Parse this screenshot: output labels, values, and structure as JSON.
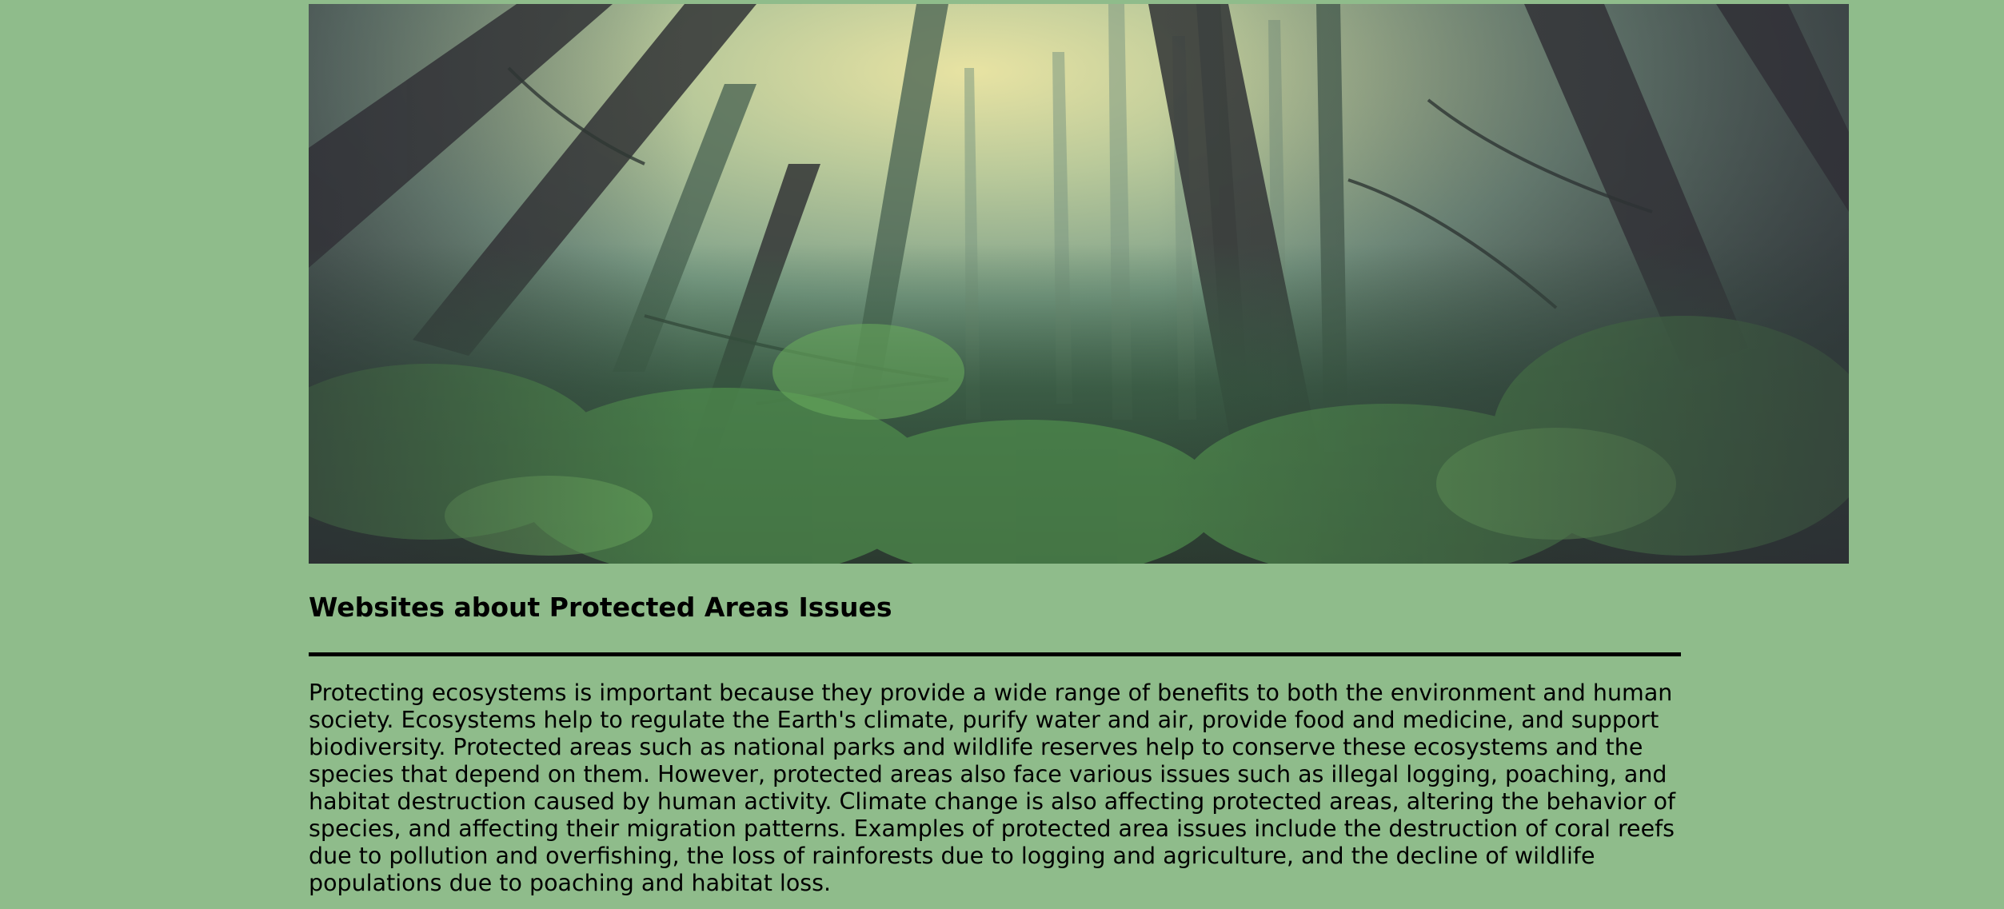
{
  "hero_image": {
    "alt": "Misty forest with tall trees viewed from below"
  },
  "heading": "Websites about Protected Areas Issues",
  "paragraph": "Protecting ecosystems is important because they provide a wide range of benefits to both the environment and human society. Ecosystems help to regulate the Earth's climate, purify water and air, provide food and medicine, and support biodiversity. Protected areas such as national parks and wildlife reserves help to conserve these ecosystems and the species that depend on them. However, protected areas also face various issues such as illegal logging, poaching, and habitat destruction caused by human activity. Climate change is also affecting protected areas, altering the behavior of species, and affecting their migration patterns. Examples of protected area issues include the destruction of coral reefs due to pollution and overfishing, the loss of rainforests due to logging and agriculture, and the decline of wildlife populations due to poaching and habitat loss.",
  "colors": {
    "background": "#8fbc8b",
    "text": "#000000",
    "divider": "#000000"
  }
}
